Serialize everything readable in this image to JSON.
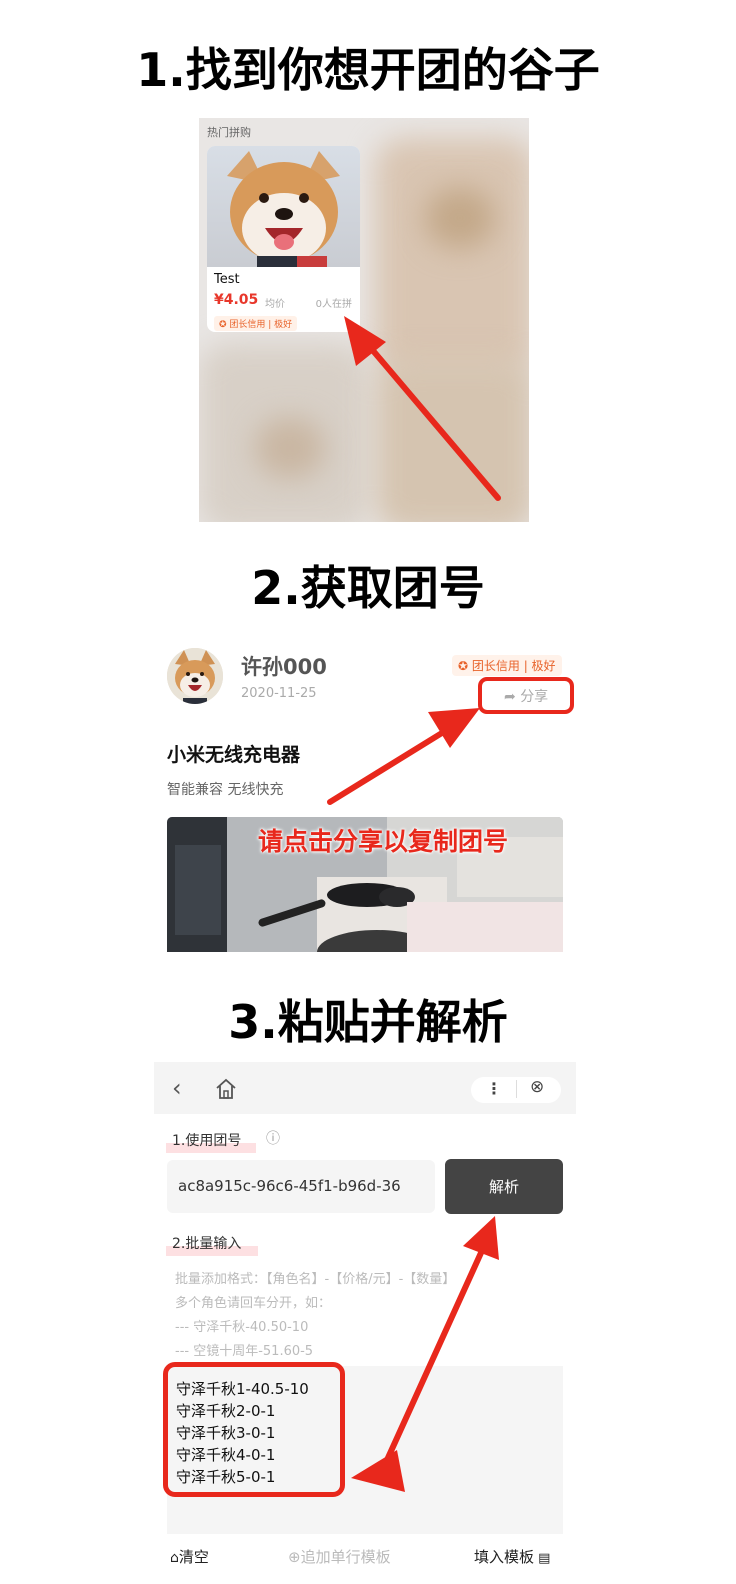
{
  "steps": {
    "step1": "1.找到你想开团的谷子",
    "step2": "2.获取团号",
    "step3": "3.粘贴并解析"
  },
  "section1": {
    "header": "热门拼购",
    "card": {
      "title": "Test",
      "price": "¥4.05",
      "unit": "均价",
      "count": "0人在拼",
      "badge": "团长信用 | 极好"
    }
  },
  "section2": {
    "user_name": "许孙000",
    "date": "2020-11-25",
    "credit_badge": "团长信用 | 极好",
    "share_label": "分享",
    "product_title": "小米无线充电器",
    "product_subtitle": "智能兼容 无线快充",
    "photo_caption": "请点击分享以复制团号"
  },
  "section3": {
    "group_label": "1.使用团号",
    "group_code": "ac8a915c-96c6-45f1-b96d-36",
    "parse_button": "解析",
    "batch_label": "2.批量输入",
    "hint_lines": [
      "批量添加格式：【角色名】-【价格/元】-【数量】",
      "多个角色请回车分开，如：",
      "--- 守泽千秋-40.50-10",
      "--- 空镜十周年-51.60-5"
    ],
    "entries": [
      "守泽千秋1-40.5-10",
      "守泽千秋2-0-1",
      "守泽千秋3-0-1",
      "守泽千秋4-0-1",
      "守泽千秋5-0-1"
    ],
    "clear_label": "清空",
    "add_row_label": "追加单行模板",
    "fill_template_label": "填入模板"
  },
  "colors": {
    "accent_red": "#e8281c",
    "price_red": "#e8372b",
    "button_dark": "#444444"
  }
}
